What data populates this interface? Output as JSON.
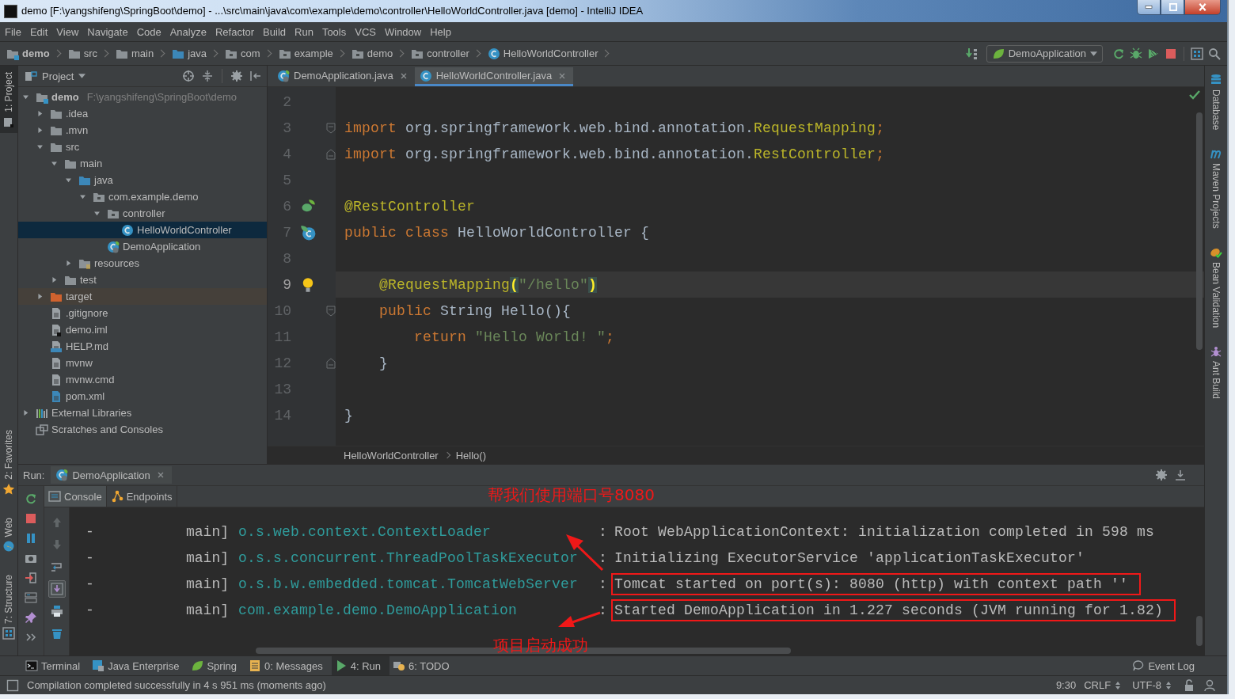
{
  "window": {
    "title": "demo [F:\\yangshifeng\\SpringBoot\\demo] - ...\\src\\main\\java\\com\\example\\demo\\controller\\HelloWorldController.java [demo] - IntelliJ IDEA"
  },
  "menu": [
    "File",
    "Edit",
    "View",
    "Navigate",
    "Code",
    "Analyze",
    "Refactor",
    "Build",
    "Run",
    "Tools",
    "VCS",
    "Window",
    "Help"
  ],
  "navigation": {
    "crumbs": [
      {
        "label": "demo",
        "kind": "module"
      },
      {
        "label": "src",
        "kind": "folder"
      },
      {
        "label": "main",
        "kind": "folder"
      },
      {
        "label": "java",
        "kind": "source"
      },
      {
        "label": "com",
        "kind": "package"
      },
      {
        "label": "example",
        "kind": "package"
      },
      {
        "label": "demo",
        "kind": "package"
      },
      {
        "label": "controller",
        "kind": "package"
      },
      {
        "label": "HelloWorldController",
        "kind": "class"
      }
    ],
    "run_configuration": "DemoApplication"
  },
  "left_strip": {
    "top": [
      {
        "label": "1: Project",
        "kind": "project",
        "selected": true
      }
    ],
    "bottom": [
      {
        "label": "2: Favorites",
        "kind": "favorites",
        "selected": false
      },
      {
        "label": "Web",
        "kind": "web",
        "selected": false
      },
      {
        "label": "7: Structure",
        "kind": "structure",
        "selected": false
      }
    ]
  },
  "right_strip": [
    {
      "label": "Database",
      "kind": "database"
    },
    {
      "label": "Maven Projects",
      "kind": "maven"
    },
    {
      "label": "Bean Validation",
      "kind": "bean"
    },
    {
      "label": "Ant Build",
      "kind": "ant"
    }
  ],
  "project_panel": {
    "title": "Project",
    "tree": [
      {
        "name": "demo",
        "path": "F:\\yangshifeng\\SpringBoot\\demo",
        "kind": "module",
        "expanded": true,
        "selected": false,
        "children": [
          {
            "name": ".idea",
            "kind": "folder",
            "expanded": false,
            "selected": false
          },
          {
            "name": ".mvn",
            "kind": "folder",
            "expanded": false,
            "selected": false
          },
          {
            "name": "src",
            "kind": "folder",
            "expanded": true,
            "selected": false,
            "children": [
              {
                "name": "main",
                "kind": "folder",
                "expanded": true,
                "selected": false,
                "children": [
                  {
                    "name": "java",
                    "kind": "source",
                    "expanded": true,
                    "selected": false,
                    "children": [
                      {
                        "name": "com.example.demo",
                        "kind": "package",
                        "expanded": true,
                        "selected": false,
                        "children": [
                          {
                            "name": "controller",
                            "kind": "package",
                            "expanded": true,
                            "selected": false,
                            "children": [
                              {
                                "name": "HelloWorldController",
                                "kind": "class",
                                "selected": true
                              }
                            ]
                          },
                          {
                            "name": "DemoApplication",
                            "kind": "spring-class",
                            "selected": false
                          }
                        ]
                      }
                    ]
                  },
                  {
                    "name": "resources",
                    "kind": "resources",
                    "expanded": false,
                    "selected": false
                  }
                ]
              },
              {
                "name": "test",
                "kind": "folder",
                "expanded": false,
                "selected": false
              }
            ]
          },
          {
            "name": "target",
            "kind": "excluded",
            "expanded": false,
            "selected": false
          },
          {
            "name": ".gitignore",
            "kind": "file",
            "selected": false
          },
          {
            "name": "demo.iml",
            "kind": "iml",
            "selected": false
          },
          {
            "name": "HELP.md",
            "kind": "md",
            "selected": false
          },
          {
            "name": "mvnw",
            "kind": "file",
            "selected": false
          },
          {
            "name": "mvnw.cmd",
            "kind": "file",
            "selected": false
          },
          {
            "name": "pom.xml",
            "kind": "maven",
            "selected": false
          }
        ]
      },
      {
        "name": "External Libraries",
        "kind": "libraries",
        "expanded": false,
        "selected": false
      },
      {
        "name": "Scratches and Consoles",
        "kind": "scratches",
        "selected": false
      }
    ]
  },
  "editor": {
    "tabs": [
      {
        "label": "DemoApplication.java",
        "kind": "spring-class",
        "selected": false
      },
      {
        "label": "HelloWorldController.java",
        "kind": "class",
        "selected": true
      }
    ],
    "lines": [
      {
        "number": "2",
        "current": false
      },
      {
        "number": "3",
        "current": false,
        "fold": {
          "kind": "start"
        },
        "tokens": [
          {
            "kind": "keyword",
            "text": "import"
          },
          {
            "kind": "plain",
            "text": " org.springframework.web.bind.annotation."
          },
          {
            "kind": "annotation",
            "text": "RequestMapping"
          },
          {
            "kind": "keyword",
            "text": ";"
          }
        ]
      },
      {
        "number": "4",
        "current": false,
        "fold": {
          "kind": "end"
        },
        "tokens": [
          {
            "kind": "keyword",
            "text": "import"
          },
          {
            "kind": "plain",
            "text": " org.springframework.web.bind.annotation."
          },
          {
            "kind": "annotation",
            "text": "RestController"
          },
          {
            "kind": "keyword",
            "text": ";"
          }
        ]
      },
      {
        "number": "5",
        "current": false
      },
      {
        "number": "6",
        "current": false,
        "gutter": {
          "kind": "bean"
        },
        "tokens": [
          {
            "kind": "annotation",
            "text": "@RestController"
          }
        ]
      },
      {
        "number": "7",
        "current": false,
        "gutter": {
          "kind": "run"
        },
        "tokens": [
          {
            "kind": "keyword",
            "text": "public class"
          },
          {
            "kind": "plain",
            "text": " HelloWorldController {"
          }
        ]
      },
      {
        "number": "8",
        "current": false
      },
      {
        "number": "9",
        "current": true,
        "gutter": {
          "kind": "bulb"
        },
        "tokens": [
          {
            "kind": "annotation",
            "text": "    @RequestMapping"
          },
          {
            "kind": "match",
            "text": "("
          },
          {
            "kind": "string",
            "text": "\"/hello\""
          },
          {
            "kind": "match",
            "text": ")"
          }
        ]
      },
      {
        "number": "10",
        "current": false,
        "fold": {
          "kind": "start"
        },
        "tokens": [
          {
            "kind": "keyword",
            "text": "    public"
          },
          {
            "kind": "plain",
            "text": " String Hello(){"
          }
        ]
      },
      {
        "number": "11",
        "current": false,
        "tokens": [
          {
            "kind": "keyword",
            "text": "        return"
          },
          {
            "kind": "string",
            "text": " \"Hello World! \""
          },
          {
            "kind": "keyword",
            "text": ";"
          }
        ]
      },
      {
        "number": "12",
        "current": false,
        "fold": {
          "kind": "end"
        },
        "tokens": [
          {
            "kind": "plain",
            "text": "    }"
          }
        ]
      },
      {
        "number": "13",
        "current": false
      },
      {
        "number": "14",
        "current": false,
        "tokens": [
          {
            "kind": "plain",
            "text": "}"
          }
        ]
      }
    ],
    "breadcrumb": [
      "HelloWorldController",
      "Hello()"
    ]
  },
  "run_panel": {
    "label": "Run:",
    "tab": "DemoApplication",
    "subtabs": [
      {
        "label": "Console",
        "kind": "console",
        "selected": true
      },
      {
        "label": "Endpoints",
        "kind": "endpoints",
        "selected": false
      }
    ],
    "toolbar": [
      {
        "kind": "rerun"
      },
      {
        "kind": "stop"
      },
      {
        "kind": "pause"
      },
      {
        "kind": "camera"
      },
      {
        "kind": "login"
      },
      {
        "kind": "layout"
      },
      {
        "kind": "pin"
      },
      {
        "kind": "more"
      }
    ],
    "console_toolbar": [
      {
        "kind": "up",
        "disabled": true,
        "on": false
      },
      {
        "kind": "down",
        "disabled": true,
        "on": false
      },
      {
        "kind": "wrap",
        "disabled": false,
        "on": false
      },
      {
        "kind": "scroll-end",
        "disabled": false,
        "on": true
      },
      {
        "kind": "print",
        "disabled": false,
        "on": false
      },
      {
        "kind": "trash",
        "disabled": false,
        "on": false
      }
    ],
    "log": [
      {
        "prefix": "-",
        "thread": "main]",
        "logger": "o.s.web.context.ContextLoader",
        "separator": ":",
        "message": "Root WebApplicationContext: initialization completed in 598 ms",
        "boxed": false
      },
      {
        "prefix": "-",
        "thread": "main]",
        "logger": "o.s.s.concurrent.ThreadPoolTaskExecutor",
        "separator": ":",
        "message": "Initializing ExecutorService 'applicationTaskExecutor'",
        "boxed": false
      },
      {
        "prefix": "-",
        "thread": "main]",
        "logger": "o.s.b.w.embedded.tomcat.TomcatWebServer",
        "separator": ":",
        "message": "Tomcat started on port(s): 8080 (http) with context path ''",
        "boxed": true
      },
      {
        "prefix": "-",
        "thread": "main]",
        "logger": "com.example.demo.DemoApplication",
        "separator": ":",
        "message": "Started DemoApplication in 1.227 seconds (JVM running for 1.82)",
        "boxed": true
      }
    ],
    "annotations": [
      {
        "text": "帮我们使用端口号8080"
      },
      {
        "text": "项目启动成功"
      }
    ]
  },
  "tool_tabs": [
    {
      "label": "Terminal",
      "kind": "terminal",
      "selected": false
    },
    {
      "label": "Java Enterprise",
      "kind": "javaee",
      "selected": false
    },
    {
      "label": "Spring",
      "kind": "spring",
      "selected": false
    },
    {
      "label": "0: Messages",
      "kind": "messages",
      "selected": false
    },
    {
      "label": "4: Run",
      "kind": "run",
      "selected": true
    },
    {
      "label": "6: TODO",
      "kind": "todo",
      "selected": false
    }
  ],
  "event_log": "Event Log",
  "status": {
    "message": "Compilation completed successfully in 4 s 951 ms (moments ago)",
    "position": "9:30",
    "line_separator": "CRLF",
    "encoding": "UTF-8"
  }
}
